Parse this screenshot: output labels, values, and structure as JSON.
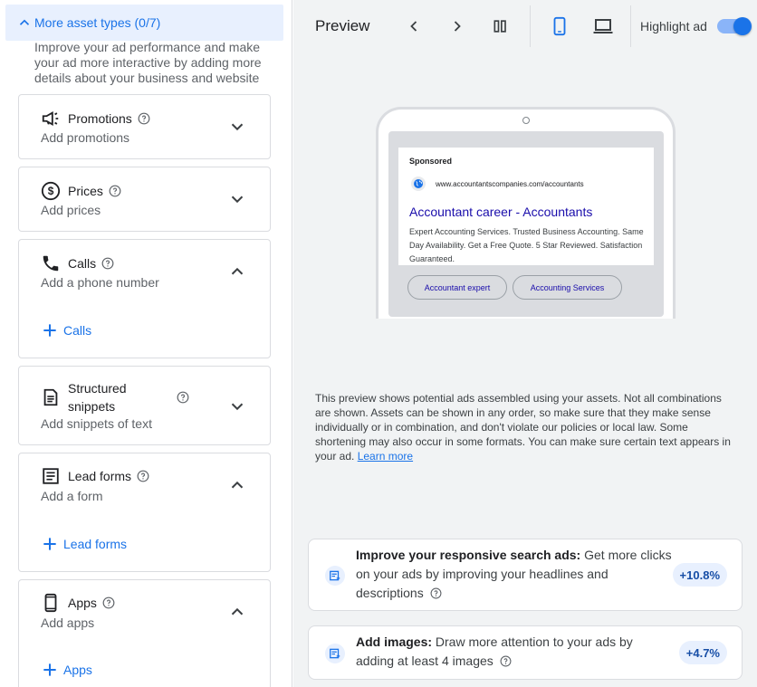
{
  "left_panel": {
    "group_header": "More asset types (0/7)",
    "intro": "Improve your ad performance and make your ad more interactive by adding more details about your business and website",
    "cards": [
      {
        "title": "Promotions",
        "subtitle": "Add promotions",
        "icon": "megaphone-icon",
        "expanded": false
      },
      {
        "title": "Prices",
        "subtitle": "Add prices",
        "icon": "dollar-circle-icon",
        "expanded": false
      },
      {
        "title": "Calls",
        "subtitle": "Add a phone number",
        "icon": "phone-icon",
        "expanded": true,
        "add_label": "Calls"
      },
      {
        "title": "Structured snippets",
        "subtitle": "Add snippets of text",
        "icon": "document-icon",
        "expanded": false
      },
      {
        "title": "Lead forms",
        "subtitle": "Add a form",
        "icon": "form-icon",
        "expanded": true,
        "add_label": "Lead forms"
      },
      {
        "title": "Apps",
        "subtitle": "Add apps",
        "icon": "smartphone-icon",
        "expanded": true,
        "add_label": "Apps"
      }
    ]
  },
  "preview": {
    "title": "Preview",
    "highlight_label": "Highlight ad",
    "highlight_on": true,
    "ad": {
      "sponsored": "Sponsored",
      "url": "www.accountantscompanies.com/accountants",
      "headline": "Accountant career - Accountants",
      "description": "Expert Accounting Services. Trusted Business Accounting. Same Day Availability. Get a Free Quote. 5 Star Reviewed. Satisfaction Guaranteed.",
      "chips": [
        "Accountant expert",
        "Accounting Services"
      ]
    },
    "disclaimer": "This preview shows potential ads assembled using your assets. Not all combinations are shown. Assets can be shown in any order, so make sure that they make sense individually or in combination, and don't violate our policies or local law. Some shortening may also occur in some formats. You can make sure certain text appears in your ad.",
    "learn_more": "Learn more"
  },
  "recommendations": [
    {
      "bold": "Improve your responsive search ads:",
      "text": " Get more clicks on your ads by improving your headlines and descriptions",
      "badge": "+10.8%"
    },
    {
      "bold": "Add images:",
      "text": " Draw more attention to your ads by adding at least 4 images",
      "badge": "+4.7%"
    }
  ],
  "colors": {
    "accent": "#1a73e8",
    "headline": "#1a0dab",
    "panel_bg": "#f1f3f4"
  }
}
